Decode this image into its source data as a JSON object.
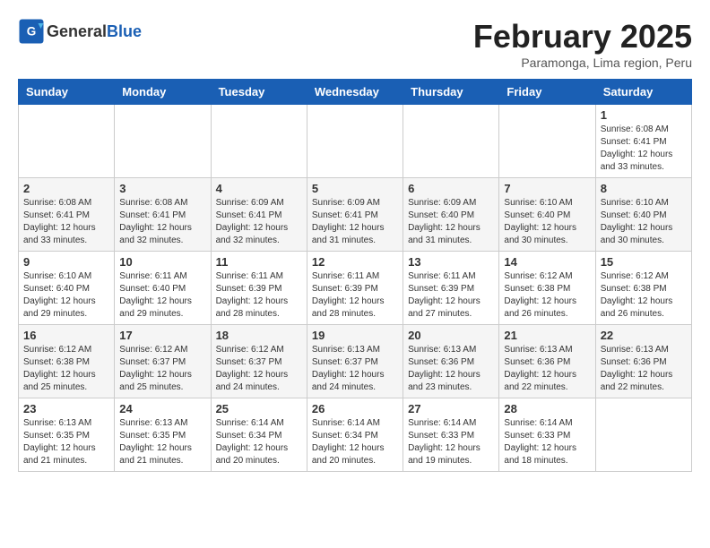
{
  "header": {
    "logo_general": "General",
    "logo_blue": "Blue",
    "month": "February 2025",
    "location": "Paramonga, Lima region, Peru"
  },
  "weekdays": [
    "Sunday",
    "Monday",
    "Tuesday",
    "Wednesday",
    "Thursday",
    "Friday",
    "Saturday"
  ],
  "weeks": [
    [
      {
        "day": "",
        "info": ""
      },
      {
        "day": "",
        "info": ""
      },
      {
        "day": "",
        "info": ""
      },
      {
        "day": "",
        "info": ""
      },
      {
        "day": "",
        "info": ""
      },
      {
        "day": "",
        "info": ""
      },
      {
        "day": "1",
        "info": "Sunrise: 6:08 AM\nSunset: 6:41 PM\nDaylight: 12 hours and 33 minutes."
      }
    ],
    [
      {
        "day": "2",
        "info": "Sunrise: 6:08 AM\nSunset: 6:41 PM\nDaylight: 12 hours and 33 minutes."
      },
      {
        "day": "3",
        "info": "Sunrise: 6:08 AM\nSunset: 6:41 PM\nDaylight: 12 hours and 32 minutes."
      },
      {
        "day": "4",
        "info": "Sunrise: 6:09 AM\nSunset: 6:41 PM\nDaylight: 12 hours and 32 minutes."
      },
      {
        "day": "5",
        "info": "Sunrise: 6:09 AM\nSunset: 6:41 PM\nDaylight: 12 hours and 31 minutes."
      },
      {
        "day": "6",
        "info": "Sunrise: 6:09 AM\nSunset: 6:40 PM\nDaylight: 12 hours and 31 minutes."
      },
      {
        "day": "7",
        "info": "Sunrise: 6:10 AM\nSunset: 6:40 PM\nDaylight: 12 hours and 30 minutes."
      },
      {
        "day": "8",
        "info": "Sunrise: 6:10 AM\nSunset: 6:40 PM\nDaylight: 12 hours and 30 minutes."
      }
    ],
    [
      {
        "day": "9",
        "info": "Sunrise: 6:10 AM\nSunset: 6:40 PM\nDaylight: 12 hours and 29 minutes."
      },
      {
        "day": "10",
        "info": "Sunrise: 6:11 AM\nSunset: 6:40 PM\nDaylight: 12 hours and 29 minutes."
      },
      {
        "day": "11",
        "info": "Sunrise: 6:11 AM\nSunset: 6:39 PM\nDaylight: 12 hours and 28 minutes."
      },
      {
        "day": "12",
        "info": "Sunrise: 6:11 AM\nSunset: 6:39 PM\nDaylight: 12 hours and 28 minutes."
      },
      {
        "day": "13",
        "info": "Sunrise: 6:11 AM\nSunset: 6:39 PM\nDaylight: 12 hours and 27 minutes."
      },
      {
        "day": "14",
        "info": "Sunrise: 6:12 AM\nSunset: 6:38 PM\nDaylight: 12 hours and 26 minutes."
      },
      {
        "day": "15",
        "info": "Sunrise: 6:12 AM\nSunset: 6:38 PM\nDaylight: 12 hours and 26 minutes."
      }
    ],
    [
      {
        "day": "16",
        "info": "Sunrise: 6:12 AM\nSunset: 6:38 PM\nDaylight: 12 hours and 25 minutes."
      },
      {
        "day": "17",
        "info": "Sunrise: 6:12 AM\nSunset: 6:37 PM\nDaylight: 12 hours and 25 minutes."
      },
      {
        "day": "18",
        "info": "Sunrise: 6:12 AM\nSunset: 6:37 PM\nDaylight: 12 hours and 24 minutes."
      },
      {
        "day": "19",
        "info": "Sunrise: 6:13 AM\nSunset: 6:37 PM\nDaylight: 12 hours and 24 minutes."
      },
      {
        "day": "20",
        "info": "Sunrise: 6:13 AM\nSunset: 6:36 PM\nDaylight: 12 hours and 23 minutes."
      },
      {
        "day": "21",
        "info": "Sunrise: 6:13 AM\nSunset: 6:36 PM\nDaylight: 12 hours and 22 minutes."
      },
      {
        "day": "22",
        "info": "Sunrise: 6:13 AM\nSunset: 6:36 PM\nDaylight: 12 hours and 22 minutes."
      }
    ],
    [
      {
        "day": "23",
        "info": "Sunrise: 6:13 AM\nSunset: 6:35 PM\nDaylight: 12 hours and 21 minutes."
      },
      {
        "day": "24",
        "info": "Sunrise: 6:13 AM\nSunset: 6:35 PM\nDaylight: 12 hours and 21 minutes."
      },
      {
        "day": "25",
        "info": "Sunrise: 6:14 AM\nSunset: 6:34 PM\nDaylight: 12 hours and 20 minutes."
      },
      {
        "day": "26",
        "info": "Sunrise: 6:14 AM\nSunset: 6:34 PM\nDaylight: 12 hours and 20 minutes."
      },
      {
        "day": "27",
        "info": "Sunrise: 6:14 AM\nSunset: 6:33 PM\nDaylight: 12 hours and 19 minutes."
      },
      {
        "day": "28",
        "info": "Sunrise: 6:14 AM\nSunset: 6:33 PM\nDaylight: 12 hours and 18 minutes."
      },
      {
        "day": "",
        "info": ""
      }
    ]
  ]
}
